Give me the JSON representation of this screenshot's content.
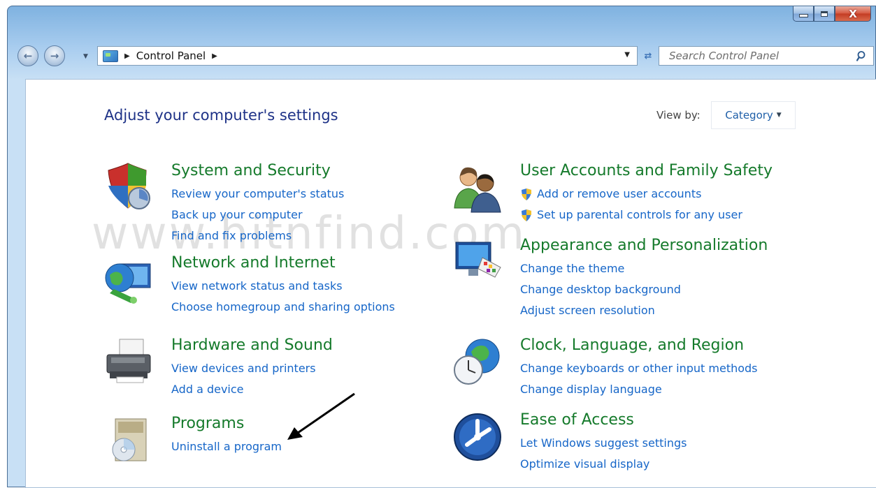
{
  "nav": {
    "breadcrumb": "Control Panel",
    "search_placeholder": "Search Control Panel"
  },
  "window": {
    "close_label": "X"
  },
  "header": {
    "title": "Adjust your computer's settings",
    "view_by_label": "View by:",
    "view_by_value": "Category"
  },
  "categories": [
    {
      "title": "System and Security",
      "icon": "shield-windows-icon",
      "links": [
        "Review your computer's status",
        "Back up your computer",
        "Find and fix problems"
      ]
    },
    {
      "title": "Network and Internet",
      "icon": "globe-network-icon",
      "links": [
        "View network status and tasks",
        "Choose homegroup and sharing options"
      ]
    },
    {
      "title": "Hardware and Sound",
      "icon": "printer-icon",
      "links": [
        "View devices and printers",
        "Add a device"
      ]
    },
    {
      "title": "Programs",
      "icon": "programs-box-icon",
      "links": [
        "Uninstall a program"
      ]
    },
    {
      "title": "User Accounts and Family Safety",
      "icon": "users-icon",
      "links": [
        "Add or remove user accounts",
        "Set up parental controls for any user"
      ]
    },
    {
      "title": "Appearance and Personalization",
      "icon": "monitor-palette-icon",
      "links": [
        "Change the theme",
        "Change desktop background",
        "Adjust screen resolution"
      ]
    },
    {
      "title": "Clock, Language, and Region",
      "icon": "clock-globe-icon",
      "links": [
        "Change keyboards or other input methods",
        "Change display language"
      ]
    },
    {
      "title": "Ease of Access",
      "icon": "ease-of-access-icon",
      "links": [
        "Let Windows suggest settings",
        "Optimize visual display"
      ]
    }
  ],
  "watermark": "www.hitnfind.com",
  "colors": {
    "category_title": "#157a2b",
    "link": "#1666c8",
    "page_title": "#1e3287"
  }
}
